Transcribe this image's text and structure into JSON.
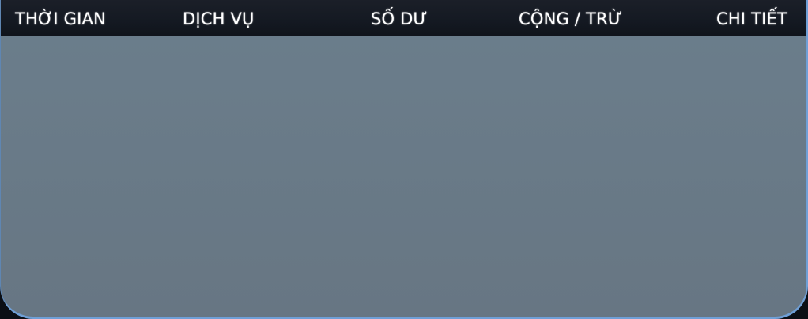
{
  "table": {
    "columns": [
      {
        "label": "THỜI GIAN"
      },
      {
        "label": "DỊCH VỤ"
      },
      {
        "label": "SỐ DƯ"
      },
      {
        "label": "CỘNG / TRỪ"
      },
      {
        "label": "CHI TIẾT"
      }
    ],
    "rows": []
  }
}
